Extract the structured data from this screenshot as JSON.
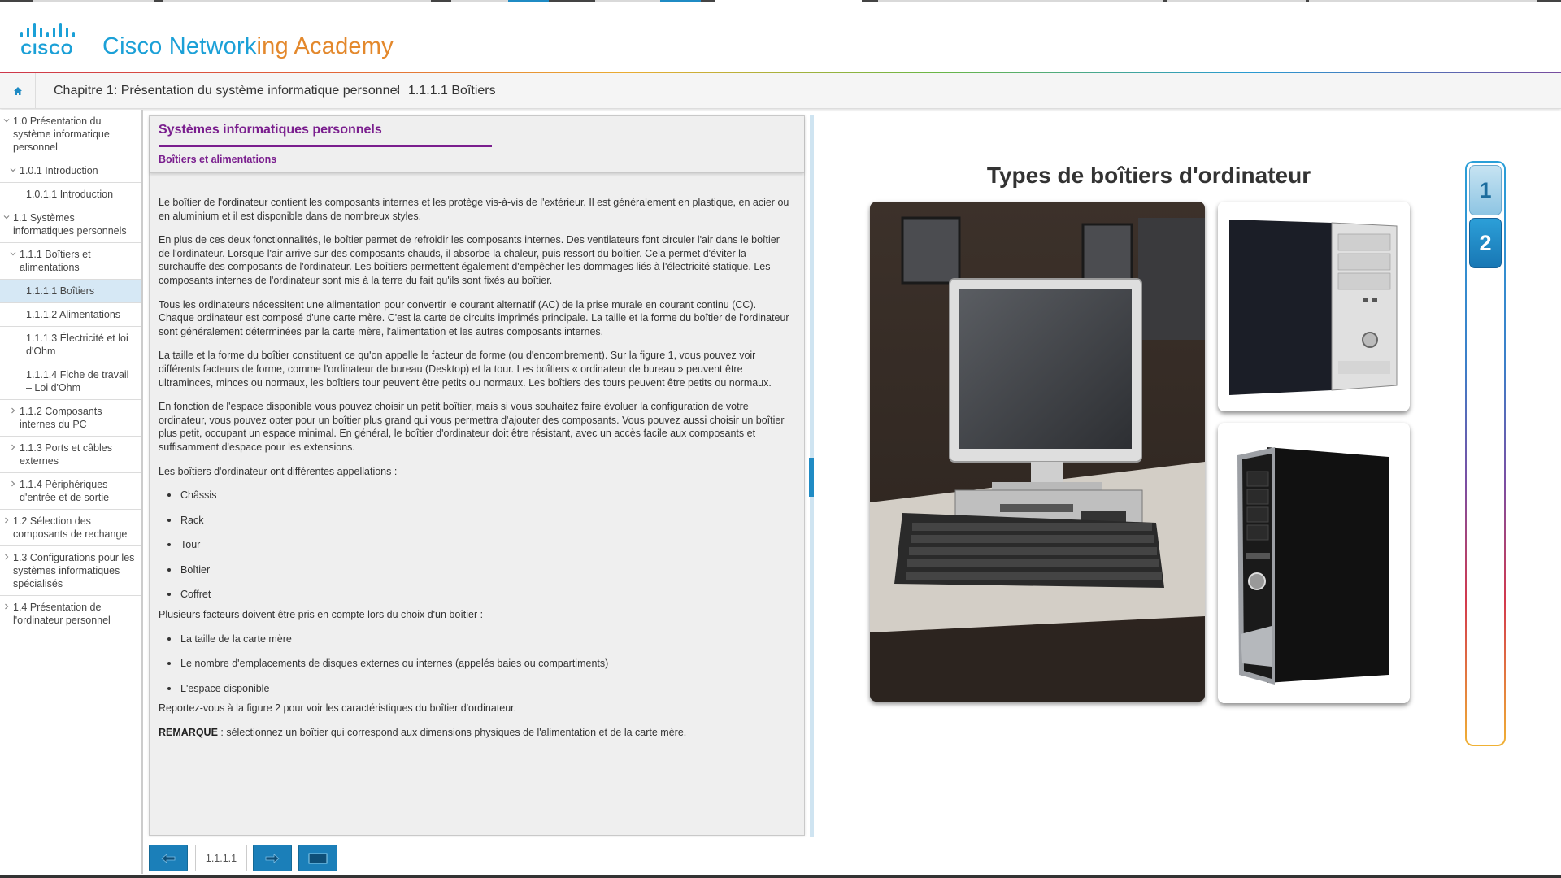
{
  "header": {
    "brand_part1": "Cisco Network",
    "brand_part2": "ing",
    "brand_part3": " Academy",
    "logo_text": "CISCO"
  },
  "breadcrumb": {
    "chapter": "Chapitre 1: Présentation du système informatique personnel",
    "separator": "›",
    "page": "1.1.1.1 Boîtiers"
  },
  "sidebar": {
    "items": [
      {
        "label": "1.0 Présentation du système informatique personnel"
      },
      {
        "label": "1.0.1 Introduction"
      },
      {
        "label": "1.0.1.1 Introduction"
      },
      {
        "label": "1.1 Systèmes informatiques personnels"
      },
      {
        "label": "1.1.1 Boîtiers et alimentations"
      },
      {
        "label": "1.1.1.1 Boîtiers"
      },
      {
        "label": "1.1.1.2 Alimentations"
      },
      {
        "label": "1.1.1.3 Électricité et loi d'Ohm"
      },
      {
        "label": "1.1.1.4 Fiche de travail – Loi d'Ohm"
      },
      {
        "label": "1.1.2 Composants internes du PC"
      },
      {
        "label": "1.1.3 Ports et câbles externes"
      },
      {
        "label": "1.1.4 Périphériques d'entrée et de sortie"
      },
      {
        "label": "1.2 Sélection des composants de rechange"
      },
      {
        "label": "1.3 Configurations pour les systèmes informatiques spécialisés"
      },
      {
        "label": "1.4 Présentation de l'ordinateur personnel"
      }
    ]
  },
  "content": {
    "title": "Systèmes informatiques personnels",
    "subtitle": "Boîtiers et alimentations",
    "p1": "Le boîtier de l'ordinateur contient les composants internes et les protège vis-à-vis de l'extérieur. Il est généralement en plastique, en acier ou en aluminium et il est disponible dans de nombreux styles.",
    "p2": "En plus de ces deux fonctionnalités, le boîtier permet de refroidir les composants internes. Des ventilateurs font circuler l'air dans le boîtier de l'ordinateur. Lorsque l'air arrive sur des composants chauds, il absorbe la chaleur, puis ressort du boîtier. Cela permet d'éviter la surchauffe des composants de l'ordinateur. Les boîtiers permettent également d'empêcher les dommages liés à l'électricité statique. Les composants internes de l'ordinateur sont mis à la terre du fait qu'ils sont fixés au boîtier.",
    "p3": "Tous les ordinateurs nécessitent une alimentation pour convertir le courant alternatif (AC) de la prise murale en courant continu (CC). Chaque ordinateur est composé d'une carte mère. C'est la carte de circuits imprimés principale. La taille et la forme du boîtier de l'ordinateur sont généralement déterminées par la carte mère, l'alimentation et les autres composants internes.",
    "p4": "La taille et la forme du boîtier constituent ce qu'on appelle le facteur de forme (ou d'encombrement). Sur la figure 1, vous pouvez voir différents facteurs de forme, comme l'ordinateur de bureau (Desktop) et la tour. Les boîtiers « ordinateur de bureau » peuvent être ultraminces, minces ou normaux, les boîtiers tour peuvent être petits ou normaux. Les boîtiers des tours peuvent être petits ou normaux.",
    "p5": "En fonction de l'espace disponible vous pouvez choisir un petit boîtier, mais si vous souhaitez faire évoluer la configuration de votre ordinateur, vous pouvez opter pour un boîtier plus grand qui vous permettra d'ajouter des composants. Vous pouvez aussi choisir un boîtier plus petit, occupant un espace minimal. En général, le boîtier d'ordinateur doit être résistant, avec un accès facile aux composants et suffisamment d'espace pour les extensions.",
    "p6": "Les boîtiers d'ordinateur ont différentes appellations :",
    "list1": [
      "Châssis",
      "Rack",
      "Tour",
      "Boîtier",
      "Coffret"
    ],
    "p7": "Plusieurs facteurs doivent être pris en compte lors du choix d'un boîtier :",
    "list2": [
      "La taille de la carte mère",
      "Le nombre d'emplacements de disques externes ou internes (appelés baies ou compartiments)",
      "L'espace disponible"
    ],
    "p8": "Reportez-vous à la figure 2 pour voir les caractéristiques du boîtier d'ordinateur.",
    "note_label": "REMARQUE",
    "note_text": " : sélectionnez un boîtier qui correspond aux dimensions physiques de l'alimentation et de la carte mère."
  },
  "bottom_nav": {
    "page_number": "1.1.1.1"
  },
  "media": {
    "title": "Types de boîtiers d'ordinateur",
    "figure_tabs": [
      "1",
      "2"
    ],
    "active_tab": "1"
  }
}
